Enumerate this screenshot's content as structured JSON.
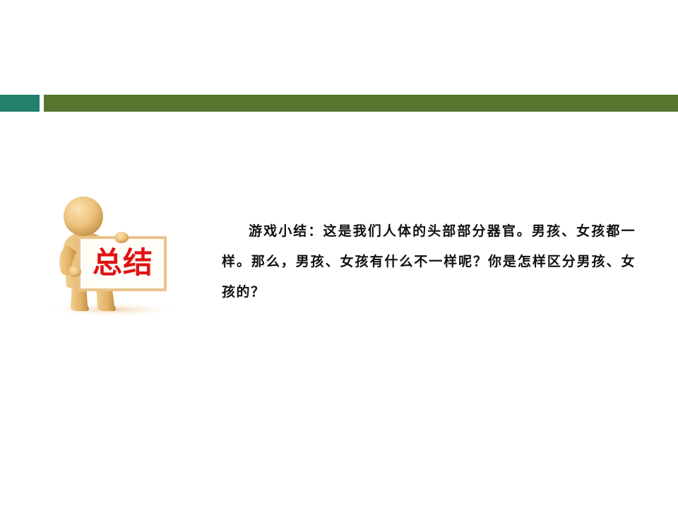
{
  "colors": {
    "bar_left": "#23806b",
    "bar_right": "#57752f",
    "sign_text": "#e01212",
    "body_text": "#111111"
  },
  "illustration": {
    "icon": "person-holding-sign-icon",
    "sign_text": "总结"
  },
  "body": {
    "text": "游戏小结：这是我们人体的头部部分器官。男孩、女孩都一样。那么，男孩、女孩有什么不一样呢？你是怎样区分男孩、女孩的？"
  }
}
